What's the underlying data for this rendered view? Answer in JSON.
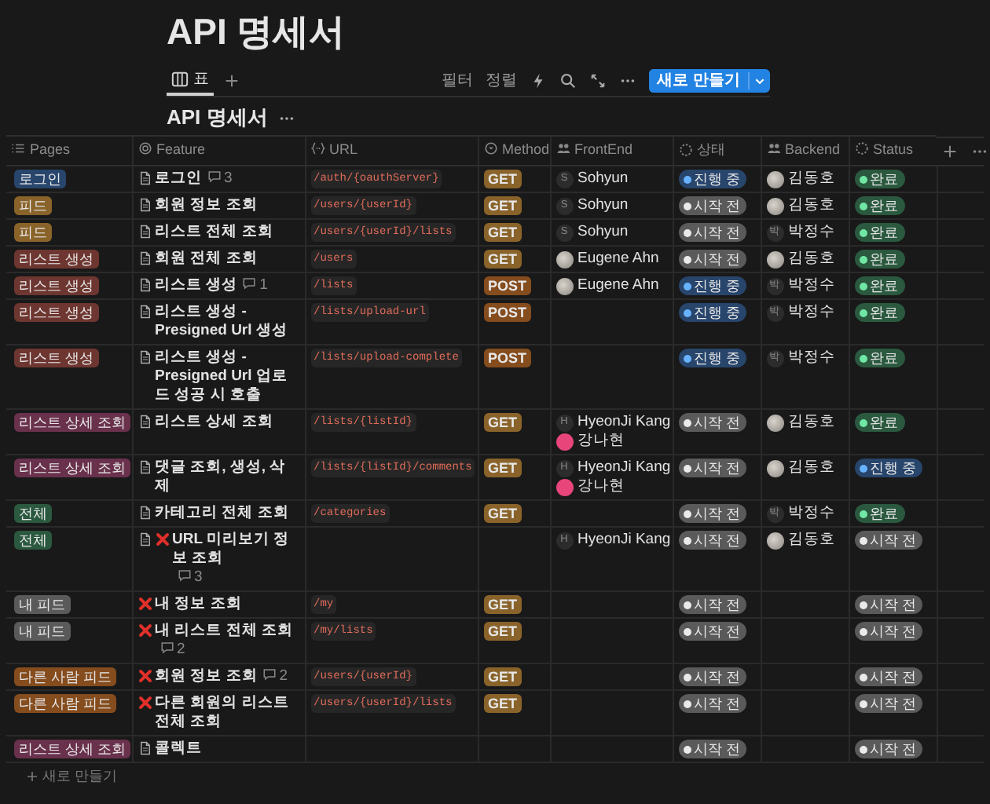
{
  "page_title": "API 명세서",
  "toolbar": {
    "views": [
      {
        "label": "표",
        "selected": true
      }
    ],
    "actions": [
      "필터",
      "정렬"
    ],
    "new_button": "새로 만들기"
  },
  "table": {
    "title": "API 명세서",
    "columns": [
      "Pages",
      "Feature",
      "URL",
      "Method",
      "FrontEnd",
      "상태",
      "Backend",
      "Status"
    ],
    "rows": [
      {
        "page": {
          "label": "로그인",
          "color": "#28456c"
        },
        "feature": {
          "kind": "page",
          "title": "로그인",
          "comments": "3"
        },
        "url": "/auth/{oauthServer}",
        "method": {
          "label": "GET",
          "color": "#89632a"
        },
        "frontend": [
          {
            "kind": "initial",
            "initial": "S",
            "name": "Sohyun"
          }
        ],
        "state": {
          "label": "진행 중",
          "color": "#28456c"
        },
        "backend": [
          {
            "kind": "photo",
            "name": "김동호"
          }
        ],
        "status": {
          "label": "완료",
          "color": "#2b593f"
        }
      },
      {
        "page": {
          "label": "피드",
          "color": "#89632a"
        },
        "feature": {
          "kind": "page",
          "title": "회원 정보 조회"
        },
        "url": "/users/{userId}",
        "method": {
          "label": "GET",
          "color": "#89632a"
        },
        "frontend": [
          {
            "kind": "initial",
            "initial": "S",
            "name": "Sohyun"
          }
        ],
        "state": {
          "label": "시작 전",
          "color": "#5a5a5a"
        },
        "backend": [
          {
            "kind": "photo",
            "name": "김동호"
          }
        ],
        "status": {
          "label": "완료",
          "color": "#2b593f"
        }
      },
      {
        "page": {
          "label": "피드",
          "color": "#89632a"
        },
        "feature": {
          "kind": "page",
          "title": "리스트 전체 조회"
        },
        "url": "/users/{userId}/lists",
        "method": {
          "label": "GET",
          "color": "#89632a"
        },
        "frontend": [
          {
            "kind": "initial",
            "initial": "S",
            "name": "Sohyun"
          }
        ],
        "state": {
          "label": "시작 전",
          "color": "#5a5a5a"
        },
        "backend": [
          {
            "kind": "initial",
            "initial": "박",
            "name": "박정수"
          }
        ],
        "status": {
          "label": "완료",
          "color": "#2b593f"
        }
      },
      {
        "page": {
          "label": "리스트 생성",
          "color": "#6e3630"
        },
        "feature": {
          "kind": "page",
          "title": "회원 전체 조회"
        },
        "url": "/users",
        "method": {
          "label": "GET",
          "color": "#89632a"
        },
        "frontend": [
          {
            "kind": "photo",
            "name": "Eugene Ahn"
          }
        ],
        "state": {
          "label": "시작 전",
          "color": "#5a5a5a"
        },
        "backend": [
          {
            "kind": "photo",
            "name": "김동호"
          }
        ],
        "status": {
          "label": "완료",
          "color": "#2b593f"
        }
      },
      {
        "page": {
          "label": "리스트 생성",
          "color": "#6e3630"
        },
        "feature": {
          "kind": "page",
          "title": "리스트 생성",
          "comments": "1"
        },
        "url": "/lists",
        "method": {
          "label": "POST",
          "color": "#854c1d"
        },
        "frontend": [
          {
            "kind": "photo",
            "name": "Eugene Ahn"
          }
        ],
        "state": {
          "label": "진행 중",
          "color": "#28456c"
        },
        "backend": [
          {
            "kind": "initial",
            "initial": "박",
            "name": "박정수"
          }
        ],
        "status": {
          "label": "완료",
          "color": "#2b593f"
        }
      },
      {
        "page": {
          "label": "리스트 생성",
          "color": "#6e3630"
        },
        "feature": {
          "kind": "page",
          "title": "리스트 생성 - Presigned Url 생성"
        },
        "url": "/lists/upload-url",
        "method": {
          "label": "POST",
          "color": "#854c1d"
        },
        "frontend": [],
        "state": {
          "label": "진행 중",
          "color": "#28456c"
        },
        "backend": [
          {
            "kind": "initial",
            "initial": "박",
            "name": "박정수"
          }
        ],
        "status": {
          "label": "완료",
          "color": "#2b593f"
        }
      },
      {
        "page": {
          "label": "리스트 생성",
          "color": "#6e3630"
        },
        "feature": {
          "kind": "page",
          "title": "리스트 생성 - Presigned Url 업로드 성공 시 호출"
        },
        "url": "/lists/upload-complete",
        "method": {
          "label": "POST",
          "color": "#854c1d"
        },
        "frontend": [],
        "state": {
          "label": "진행 중",
          "color": "#28456c"
        },
        "backend": [
          {
            "kind": "initial",
            "initial": "박",
            "name": "박정수"
          }
        ],
        "status": {
          "label": "완료",
          "color": "#2b593f"
        }
      },
      {
        "page": {
          "label": "리스트 상세 조회",
          "color": "#69314c"
        },
        "feature": {
          "kind": "page",
          "title": "리스트 상세 조회"
        },
        "url": "/lists/{listId}",
        "method": {
          "label": "GET",
          "color": "#89632a"
        },
        "frontend": [
          {
            "kind": "initial",
            "initial": "H",
            "name": "HyeonJi Kang"
          },
          {
            "kind": "pink",
            "name": "강나현"
          }
        ],
        "state": {
          "label": "시작 전",
          "color": "#5a5a5a"
        },
        "backend": [
          {
            "kind": "photo",
            "name": "김동호"
          }
        ],
        "status": {
          "label": "완료",
          "color": "#2b593f"
        }
      },
      {
        "page": {
          "label": "리스트 상세 조회",
          "color": "#69314c"
        },
        "feature": {
          "kind": "page",
          "title": "댓글 조회, 생성, 삭제"
        },
        "url": "/lists/{listId}/comments",
        "method": {
          "label": "GET",
          "color": "#89632a"
        },
        "frontend": [
          {
            "kind": "initial",
            "initial": "H",
            "name": "HyeonJi Kang"
          },
          {
            "kind": "pink",
            "name": "강나현"
          }
        ],
        "state": {
          "label": "시작 전",
          "color": "#5a5a5a"
        },
        "backend": [
          {
            "kind": "photo",
            "name": "김동호"
          }
        ],
        "status": {
          "label": "진행 중",
          "color": "#28456c"
        }
      },
      {
        "page": {
          "label": "전체",
          "color": "#2b593f"
        },
        "feature": {
          "kind": "page",
          "title": "카테고리 전체 조회"
        },
        "url": "/categories",
        "method": {
          "label": "GET",
          "color": "#89632a"
        },
        "frontend": [],
        "state": {
          "label": "시작 전",
          "color": "#5a5a5a"
        },
        "backend": [
          {
            "kind": "initial",
            "initial": "박",
            "name": "박정수"
          }
        ],
        "status": {
          "label": "완료",
          "color": "#2b593f"
        }
      },
      {
        "page": {
          "label": "전체",
          "color": "#2b593f"
        },
        "feature": {
          "kind": "page-cross",
          "title": "URL 미리보기 정보 조회",
          "comments": "3"
        },
        "frontend": [
          {
            "kind": "initial",
            "initial": "H",
            "name": "HyeonJi Kang"
          }
        ],
        "state": {
          "label": "시작 전",
          "color": "#5a5a5a"
        },
        "backend": [
          {
            "kind": "photo",
            "name": "김동호"
          }
        ],
        "status": {
          "label": "시작 전",
          "color": "#5a5a5a"
        }
      },
      {
        "page": {
          "label": "내 피드",
          "color": "#5a5a5a"
        },
        "feature": {
          "kind": "cross",
          "title": "내 정보 조회"
        },
        "url": "/my",
        "method": {
          "label": "GET",
          "color": "#89632a"
        },
        "frontend": [],
        "state": {
          "label": "시작 전",
          "color": "#5a5a5a"
        },
        "backend": [],
        "status": {
          "label": "시작 전",
          "color": "#5a5a5a"
        }
      },
      {
        "page": {
          "label": "내 피드",
          "color": "#5a5a5a"
        },
        "feature": {
          "kind": "cross",
          "title": "내 리스트 전체 조회",
          "comments": "2"
        },
        "url": "/my/lists",
        "method": {
          "label": "GET",
          "color": "#89632a"
        },
        "frontend": [],
        "state": {
          "label": "시작 전",
          "color": "#5a5a5a"
        },
        "backend": [],
        "status": {
          "label": "시작 전",
          "color": "#5a5a5a"
        }
      },
      {
        "page": {
          "label": "다른 사람 피드",
          "color": "#854c1d"
        },
        "feature": {
          "kind": "cross",
          "title": "회원 정보 조회",
          "comments": "2"
        },
        "url": "/users/{userId}",
        "method": {
          "label": "GET",
          "color": "#89632a"
        },
        "frontend": [],
        "state": {
          "label": "시작 전",
          "color": "#5a5a5a"
        },
        "backend": [],
        "status": {
          "label": "시작 전",
          "color": "#5a5a5a"
        }
      },
      {
        "page": {
          "label": "다른 사람 피드",
          "color": "#854c1d"
        },
        "feature": {
          "kind": "cross",
          "title": "다른 회원의 리스트 전체 조회"
        },
        "url": "/users/{userId}/lists",
        "method": {
          "label": "GET",
          "color": "#89632a"
        },
        "frontend": [],
        "state": {
          "label": "시작 전",
          "color": "#5a5a5a"
        },
        "backend": [],
        "status": {
          "label": "시작 전",
          "color": "#5a5a5a"
        }
      },
      {
        "page": {
          "label": "리스트 상세 조회",
          "color": "#69314c"
        },
        "feature": {
          "kind": "page",
          "title": "콜렉트"
        },
        "frontend": [],
        "state": {
          "label": "시작 전",
          "color": "#5a5a5a"
        },
        "backend": [],
        "status": {
          "label": "시작 전",
          "color": "#5a5a5a"
        }
      }
    ],
    "add_row": "새로 만들기"
  }
}
